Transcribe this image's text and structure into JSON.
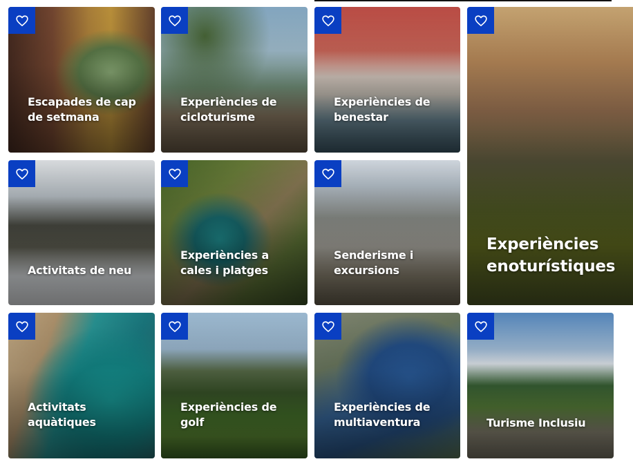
{
  "colors": {
    "favorite_bg": "#0a3fc2",
    "label": "#ffffff"
  },
  "cards": [
    {
      "title": "Escapades de cap de setmana",
      "icon": "heart-outline-icon"
    },
    {
      "title": "Experiències de cicloturisme",
      "icon": "heart-outline-icon"
    },
    {
      "title": "Experiències de benestar",
      "icon": "heart-outline-icon"
    },
    {
      "title": "Experiències enoturístiques",
      "icon": "heart-outline-icon"
    },
    {
      "title": "Activitats de neu",
      "icon": "heart-outline-icon"
    },
    {
      "title": "Experiències a cales i platges",
      "icon": "heart-outline-icon"
    },
    {
      "title": "Senderisme i excursions",
      "icon": "heart-outline-icon"
    },
    {
      "title": "Activitats aquàtiques",
      "icon": "heart-outline-icon"
    },
    {
      "title": "Experiències de golf",
      "icon": "heart-outline-icon"
    },
    {
      "title": "Experiències de multiaventura",
      "icon": "heart-outline-icon"
    },
    {
      "title": "Turisme Inclusiu",
      "icon": "heart-outline-icon"
    }
  ]
}
